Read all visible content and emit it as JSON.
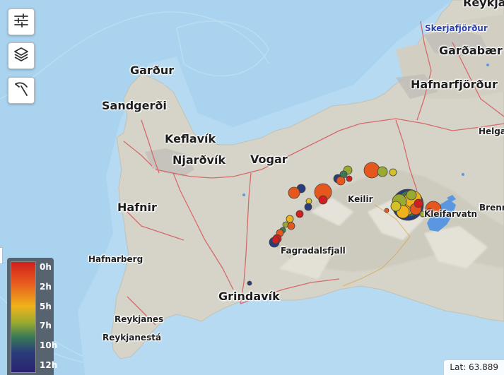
{
  "places": [
    {
      "name": "Reykjavík",
      "size": "lg"
    },
    {
      "name": "Skerjafjörður",
      "size": "water"
    },
    {
      "name": "Garðabær",
      "size": "lg"
    },
    {
      "name": "Hafnarfjörður",
      "size": "lg"
    },
    {
      "name": "Garður",
      "size": "lg"
    },
    {
      "name": "Sandgerði",
      "size": "lg"
    },
    {
      "name": "Keflavík",
      "size": "lg"
    },
    {
      "name": "Njarðvík",
      "size": "lg"
    },
    {
      "name": "Vogar",
      "size": "lg"
    },
    {
      "name": "Keilir",
      "size": "sm"
    },
    {
      "name": "Helga",
      "size": "sm"
    },
    {
      "name": "Hafnir",
      "size": "lg"
    },
    {
      "name": "Fagradalsfjall",
      "size": "sm"
    },
    {
      "name": "Kleifarvatn",
      "size": "sm"
    },
    {
      "name": "Brenn",
      "size": "sm"
    },
    {
      "name": "Hafnarberg",
      "size": "sm"
    },
    {
      "name": "Grindavík",
      "size": "lg"
    },
    {
      "name": "Reykjanes",
      "size": "sm"
    },
    {
      "name": "Reykjanestá",
      "size": "sm"
    }
  ],
  "controls": {
    "filter_icon": "sliders-icon",
    "layers_icon": "layers-icon",
    "tools_icon": "pickaxe-icon"
  },
  "legend": {
    "labels": [
      "0h",
      "2h",
      "5h",
      "7h",
      "10h",
      "12h"
    ],
    "colors": [
      "#cf1f1f",
      "#e6571d",
      "#f0b21a",
      "#9aaa30",
      "#3a7a55",
      "#2a3d7a",
      "#2a2270"
    ]
  },
  "coordinate_readout": "Lat: 63.889",
  "colors": {
    "water": "#a9d3ee",
    "land": "#d8d5c9",
    "roads": "#d56a6a",
    "lakes": "#5a97e0"
  }
}
